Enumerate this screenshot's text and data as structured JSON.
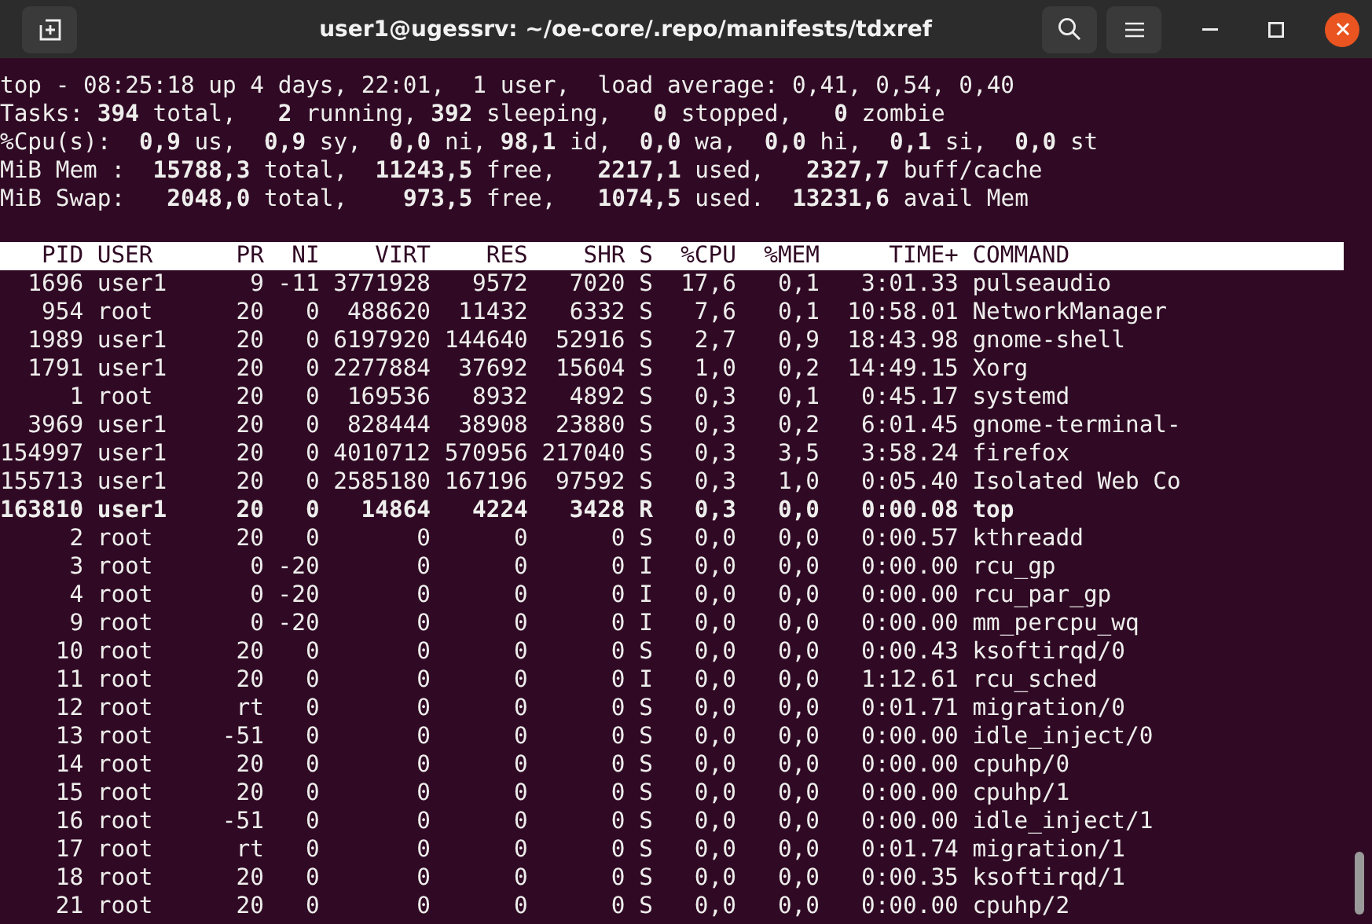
{
  "window": {
    "title": "user1@ugessrv: ~/oe-core/.repo/manifests/tdxref"
  },
  "summary": [
    "top - 08:25:18 up 4 days, 22:01,  1 user,  load average: 0,41, 0,54, 0,40",
    "Tasks: **394** total,   **2** running, **392** sleeping,   **0** stopped,   **0** zombie",
    "%Cpu(s):  **0,9** us,  **0,9** sy,  **0,0** ni, **98,1** id,  **0,0** wa,  **0,0** hi,  **0,1** si,  **0,0** st",
    "MiB Mem :  **15788,3** total,  **11243,5** free,   **2217,1** used,   **2327,7** buff/cache",
    "MiB Swap:   **2048,0** total,    **973,5** free,   **1074,5** used.  **13231,6** avail Mem"
  ],
  "table": {
    "columns": [
      "PID",
      "USER",
      "PR",
      "NI",
      "VIRT",
      "RES",
      "SHR",
      "S",
      "%CPU",
      "%MEM",
      "TIME+",
      "COMMAND"
    ],
    "rows": [
      {
        "highlighted": false,
        "cells": [
          "1696",
          "user1",
          "9",
          "-11",
          "3771928",
          "9572",
          "7020",
          "S",
          "17,6",
          "0,1",
          "3:01.33",
          "pulseaudio"
        ]
      },
      {
        "highlighted": false,
        "cells": [
          "954",
          "root",
          "20",
          "0",
          "488620",
          "11432",
          "6332",
          "S",
          "7,6",
          "0,1",
          "10:58.01",
          "NetworkManager"
        ]
      },
      {
        "highlighted": false,
        "cells": [
          "1989",
          "user1",
          "20",
          "0",
          "6197920",
          "144640",
          "52916",
          "S",
          "2,7",
          "0,9",
          "18:43.98",
          "gnome-shell"
        ]
      },
      {
        "highlighted": false,
        "cells": [
          "1791",
          "user1",
          "20",
          "0",
          "2277884",
          "37692",
          "15604",
          "S",
          "1,0",
          "0,2",
          "14:49.15",
          "Xorg"
        ]
      },
      {
        "highlighted": false,
        "cells": [
          "1",
          "root",
          "20",
          "0",
          "169536",
          "8932",
          "4892",
          "S",
          "0,3",
          "0,1",
          "0:45.17",
          "systemd"
        ]
      },
      {
        "highlighted": false,
        "cells": [
          "3969",
          "user1",
          "20",
          "0",
          "828444",
          "38908",
          "23880",
          "S",
          "0,3",
          "0,2",
          "6:01.45",
          "gnome-terminal-"
        ]
      },
      {
        "highlighted": false,
        "cells": [
          "154997",
          "user1",
          "20",
          "0",
          "4010712",
          "570956",
          "217040",
          "S",
          "0,3",
          "3,5",
          "3:58.24",
          "firefox"
        ]
      },
      {
        "highlighted": false,
        "cells": [
          "155713",
          "user1",
          "20",
          "0",
          "2585180",
          "167196",
          "97592",
          "S",
          "0,3",
          "1,0",
          "0:05.40",
          "Isolated Web Co"
        ]
      },
      {
        "highlighted": true,
        "cells": [
          "163810",
          "user1",
          "20",
          "0",
          "14864",
          "4224",
          "3428",
          "R",
          "0,3",
          "0,0",
          "0:00.08",
          "top"
        ]
      },
      {
        "highlighted": false,
        "cells": [
          "2",
          "root",
          "20",
          "0",
          "0",
          "0",
          "0",
          "S",
          "0,0",
          "0,0",
          "0:00.57",
          "kthreadd"
        ]
      },
      {
        "highlighted": false,
        "cells": [
          "3",
          "root",
          "0",
          "-20",
          "0",
          "0",
          "0",
          "I",
          "0,0",
          "0,0",
          "0:00.00",
          "rcu_gp"
        ]
      },
      {
        "highlighted": false,
        "cells": [
          "4",
          "root",
          "0",
          "-20",
          "0",
          "0",
          "0",
          "I",
          "0,0",
          "0,0",
          "0:00.00",
          "rcu_par_gp"
        ]
      },
      {
        "highlighted": false,
        "cells": [
          "9",
          "root",
          "0",
          "-20",
          "0",
          "0",
          "0",
          "I",
          "0,0",
          "0,0",
          "0:00.00",
          "mm_percpu_wq"
        ]
      },
      {
        "highlighted": false,
        "cells": [
          "10",
          "root",
          "20",
          "0",
          "0",
          "0",
          "0",
          "S",
          "0,0",
          "0,0",
          "0:00.43",
          "ksoftirqd/0"
        ]
      },
      {
        "highlighted": false,
        "cells": [
          "11",
          "root",
          "20",
          "0",
          "0",
          "0",
          "0",
          "I",
          "0,0",
          "0,0",
          "1:12.61",
          "rcu_sched"
        ]
      },
      {
        "highlighted": false,
        "cells": [
          "12",
          "root",
          "rt",
          "0",
          "0",
          "0",
          "0",
          "S",
          "0,0",
          "0,0",
          "0:01.71",
          "migration/0"
        ]
      },
      {
        "highlighted": false,
        "cells": [
          "13",
          "root",
          "-51",
          "0",
          "0",
          "0",
          "0",
          "S",
          "0,0",
          "0,0",
          "0:00.00",
          "idle_inject/0"
        ]
      },
      {
        "highlighted": false,
        "cells": [
          "14",
          "root",
          "20",
          "0",
          "0",
          "0",
          "0",
          "S",
          "0,0",
          "0,0",
          "0:00.00",
          "cpuhp/0"
        ]
      },
      {
        "highlighted": false,
        "cells": [
          "15",
          "root",
          "20",
          "0",
          "0",
          "0",
          "0",
          "S",
          "0,0",
          "0,0",
          "0:00.00",
          "cpuhp/1"
        ]
      },
      {
        "highlighted": false,
        "cells": [
          "16",
          "root",
          "-51",
          "0",
          "0",
          "0",
          "0",
          "S",
          "0,0",
          "0,0",
          "0:00.00",
          "idle_inject/1"
        ]
      },
      {
        "highlighted": false,
        "cells": [
          "17",
          "root",
          "rt",
          "0",
          "0",
          "0",
          "0",
          "S",
          "0,0",
          "0,0",
          "0:01.74",
          "migration/1"
        ]
      },
      {
        "highlighted": false,
        "cells": [
          "18",
          "root",
          "20",
          "0",
          "0",
          "0",
          "0",
          "S",
          "0,0",
          "0,0",
          "0:00.35",
          "ksoftirqd/1"
        ]
      },
      {
        "highlighted": false,
        "cells": [
          "21",
          "root",
          "20",
          "0",
          "0",
          "0",
          "0",
          "S",
          "0,0",
          "0,0",
          "0:00.00",
          "cpuhp/2"
        ]
      }
    ]
  }
}
